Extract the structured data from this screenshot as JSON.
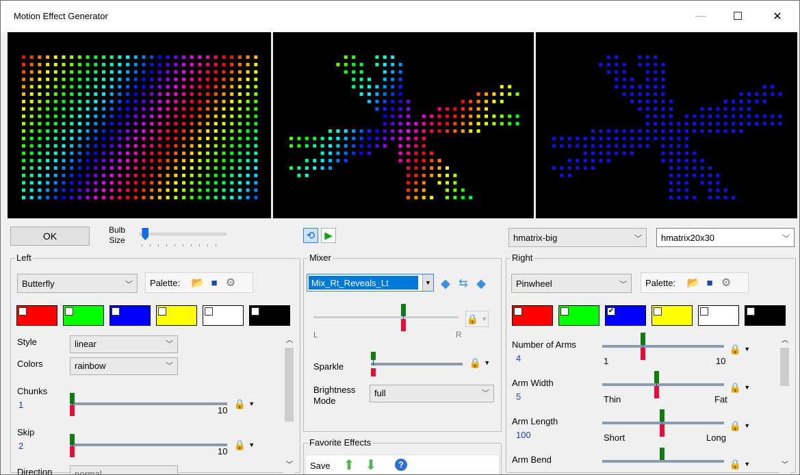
{
  "window": {
    "title": "Motion Effect Generator",
    "minimize": "—",
    "maximize": "☐",
    "close": "✕"
  },
  "top": {
    "ok_label": "OK",
    "bulb_size_label": "Bulb Size",
    "bulb_size_value": 0.02,
    "model_combo": "hmatrix-big",
    "size_combo": "hmatrix20x30"
  },
  "left": {
    "group_title": "Left",
    "effect": "Butterfly",
    "palette_label": "Palette:",
    "colors": [
      "#ff0000",
      "#00ff00",
      "#0000ff",
      "#ffff00",
      "#ffffff",
      "#000000"
    ],
    "checked": [
      false,
      false,
      false,
      false,
      false,
      false
    ],
    "style_label": "Style",
    "style_value": "linear",
    "colors_label": "Colors",
    "colors_value": "rainbow",
    "chunks_label": "Chunks",
    "chunks_value": "1",
    "chunks_max": "10",
    "skip_label": "Skip",
    "skip_value": "2",
    "skip_max": "10",
    "direction_label": "Direction",
    "direction_value": "normal"
  },
  "mixer": {
    "group_title": "Mixer",
    "mix_mode": "Mix_Rt_Reveals_Lt",
    "left_label": "L",
    "right_label": "R",
    "mix_value": 0.8,
    "sparkle_label": "Sparkle",
    "sparkle_value": 0.0,
    "brightness_label": "Brightness Mode",
    "brightness_value": "full"
  },
  "favorites": {
    "group_title": "Favorite Effects",
    "save_label": "Save"
  },
  "right": {
    "group_title": "Right",
    "effect": "Pinwheel",
    "palette_label": "Palette:",
    "colors": [
      "#ff0000",
      "#00ff00",
      "#0000ff",
      "#ffff00",
      "#ffffff",
      "#000000"
    ],
    "checked": [
      false,
      false,
      true,
      false,
      false,
      false
    ],
    "arms_label": "Number of Arms",
    "arms_value": "4",
    "arms_min": "1",
    "arms_max": "10",
    "width_label": "Arm Width",
    "width_value": "5",
    "width_min": "Thin",
    "width_max": "Fat",
    "length_label": "Arm Length",
    "length_value": "100",
    "length_min": "Short",
    "length_max": "Long",
    "bend_label": "Arm Bend"
  },
  "icons": {
    "open": "open-folder-icon",
    "save": "save-disk-icon",
    "settings": "gear-icon",
    "lock": "lock-icon",
    "loop": "loop-icon",
    "play": "play-icon",
    "move_left": "arrow-left-icon",
    "swap": "swap-icon",
    "move_right": "arrow-right-icon",
    "up": "arrow-up-green-icon",
    "down": "arrow-down-green-icon",
    "help": "help-icon"
  }
}
